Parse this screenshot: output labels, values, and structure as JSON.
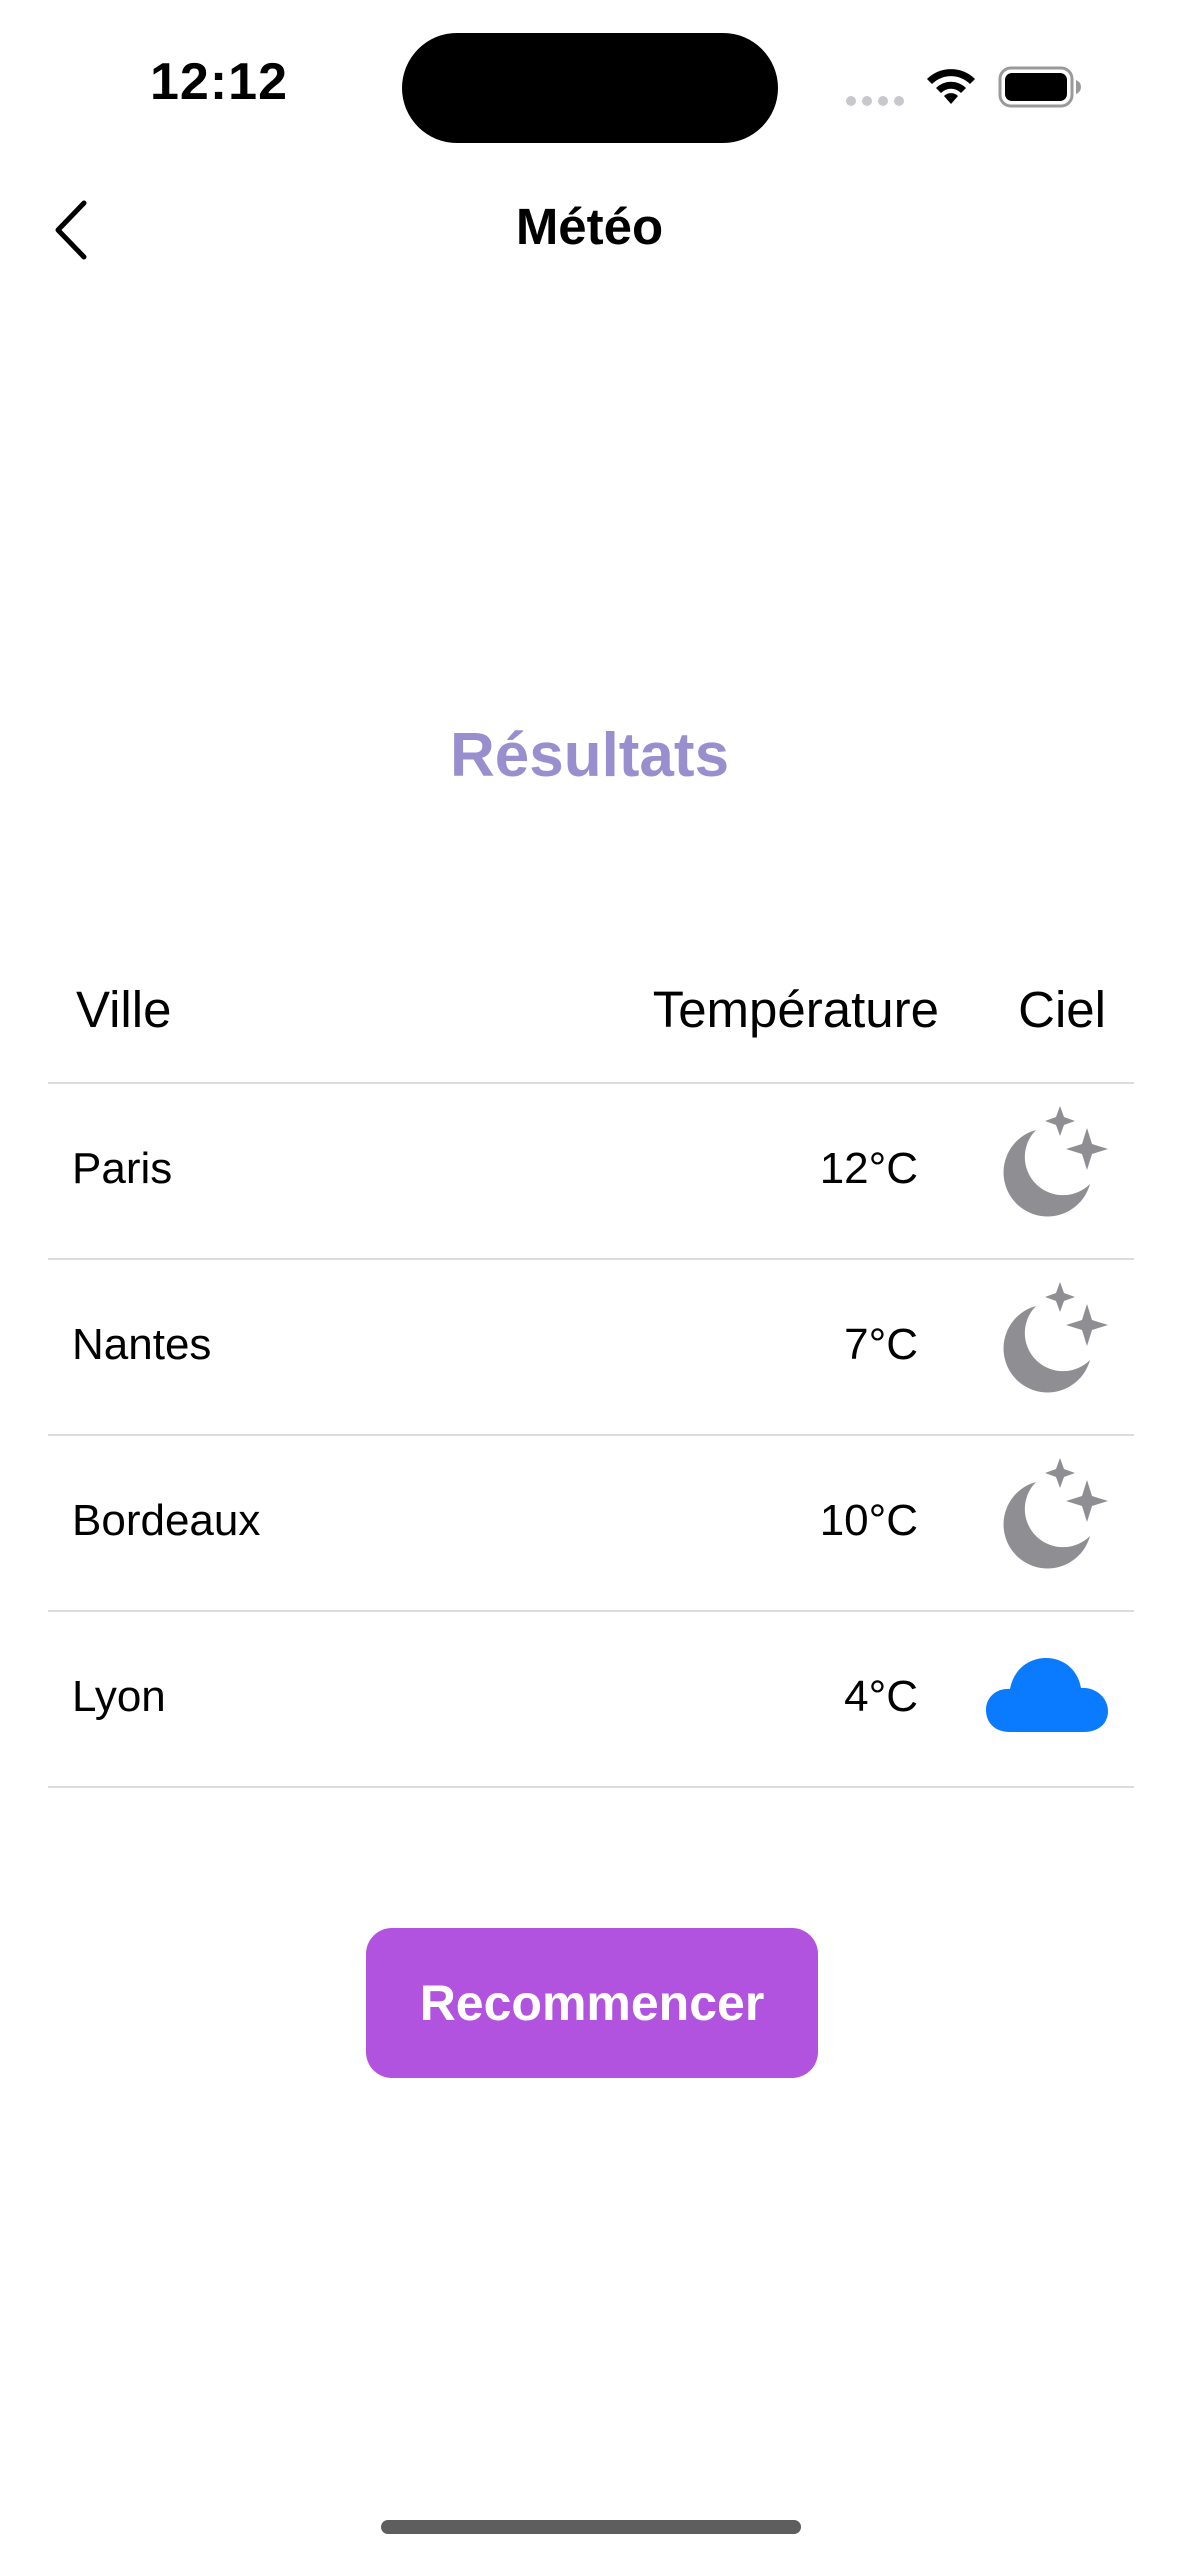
{
  "status_bar": {
    "time": "12:12"
  },
  "nav": {
    "title": "Météo"
  },
  "results": {
    "title": "Résultats"
  },
  "table": {
    "headers": {
      "city": "Ville",
      "temperature": "Température",
      "sky": "Ciel"
    },
    "rows": [
      {
        "city": "Paris",
        "temperature": "12°C",
        "sky_icon": "moon-stars-icon"
      },
      {
        "city": "Nantes",
        "temperature": "7°C",
        "sky_icon": "moon-stars-icon"
      },
      {
        "city": "Bordeaux",
        "temperature": "10°C",
        "sky_icon": "moon-stars-icon"
      },
      {
        "city": "Lyon",
        "temperature": "4°C",
        "sky_icon": "cloud-icon"
      }
    ]
  },
  "actions": {
    "restart_label": "Recommencer"
  },
  "colors": {
    "accent_title": "#9a8fce",
    "button": "#b153de",
    "moon_gray": "#8e8e93",
    "cloud_blue": "#0a7aff"
  }
}
